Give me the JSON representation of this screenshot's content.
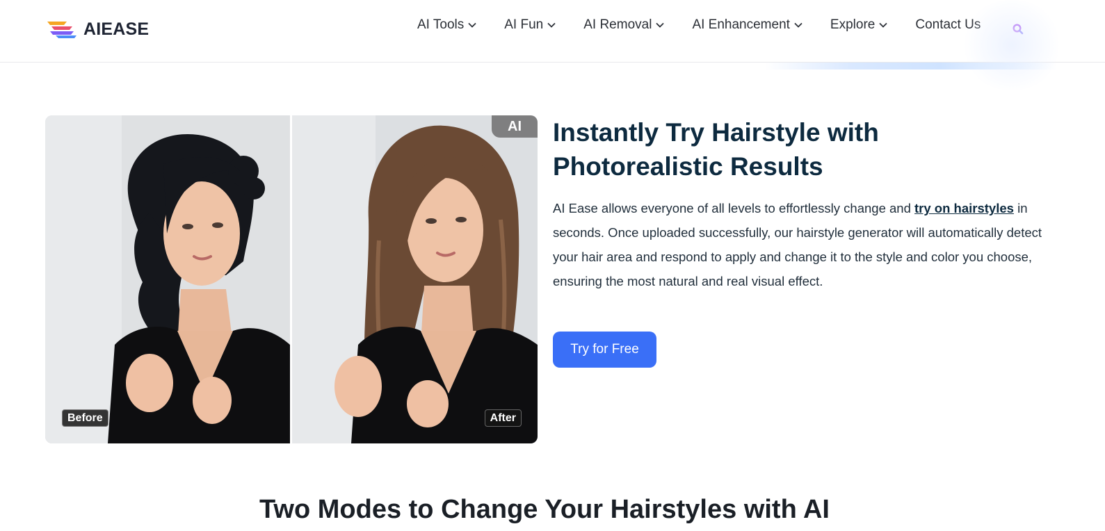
{
  "header": {
    "brand": "AIEASE",
    "nav": [
      {
        "label": "AI Tools",
        "dropdown": true
      },
      {
        "label": "AI Fun",
        "dropdown": true
      },
      {
        "label": "AI Removal",
        "dropdown": true
      },
      {
        "label": "AI Enhancement",
        "dropdown": true
      },
      {
        "label": "Explore",
        "dropdown": true
      },
      {
        "label": "Contact Us",
        "dropdown": false
      }
    ],
    "search_icon": "search-icon"
  },
  "compare": {
    "before_label": "Before",
    "after_label": "After",
    "ai_badge": "AI"
  },
  "hero": {
    "title": "Instantly Try Hairstyle with Photorealistic Results",
    "desc_before_link": "AI Ease allows everyone of all levels to effortlessly change and ",
    "desc_link": "try on hairstyles",
    "desc_after_link": " in seconds. Once uploaded successfully, our hairstyle generator will automatically detect your hair area and respond to apply and change it to the style and color you choose, ensuring the most natural and real visual effect.",
    "cta_label": "Try for Free"
  },
  "section": {
    "title": "Two Modes to Change Your Hairstyles with AI"
  },
  "colors": {
    "primary": "#3a6ff7",
    "heading": "#0d2a3f",
    "search_accent": "#9b3df0"
  }
}
